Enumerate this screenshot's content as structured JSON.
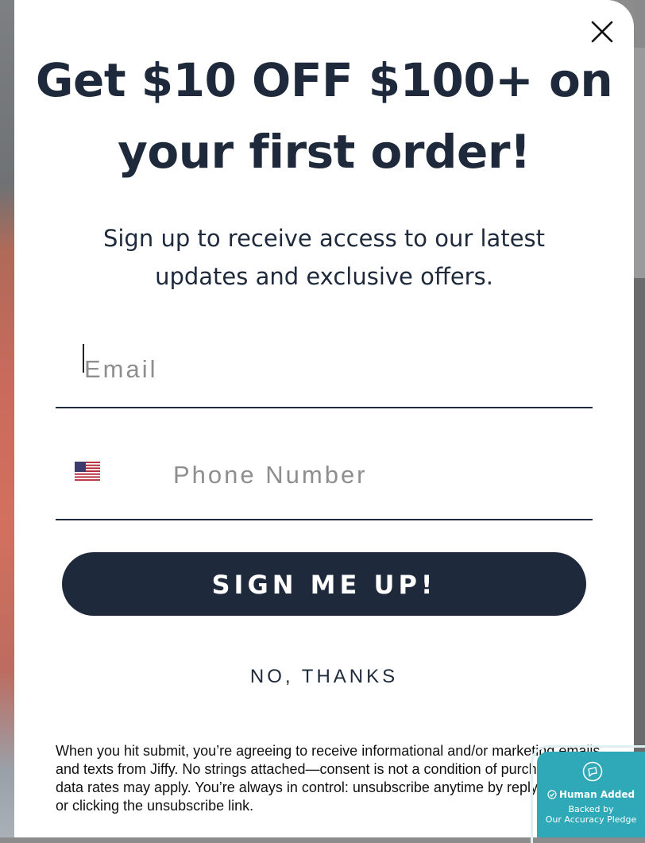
{
  "modal": {
    "headline": "Get $10 OFF $100+ on your first order!",
    "subtext": "Sign up to receive access to our latest updates and exclusive offers.",
    "email_placeholder": "Email",
    "email_value": "",
    "phone_placeholder": "Phone Number",
    "phone_value": "",
    "country_flag": "us-flag-icon",
    "signup_label": "SIGN ME UP!",
    "no_thanks_label": "NO, THANKS",
    "disclaimer": "When you hit submit, you’re agreeing to receive informational and/or marketing emails and texts from Jiffy. No strings attached—consent is not a condition of purchase. Msg & data rates may apply. You’re always in control: unsubscribe anytime by replying STOP or clicking the unsubscribe link."
  },
  "badge": {
    "title": "Human Added",
    "line1": "Backed by",
    "line2": "Our Accuracy Pledge"
  },
  "colors": {
    "primary": "#1e2a3b",
    "badge": "#2fa8b7",
    "background": "#ffffff"
  }
}
